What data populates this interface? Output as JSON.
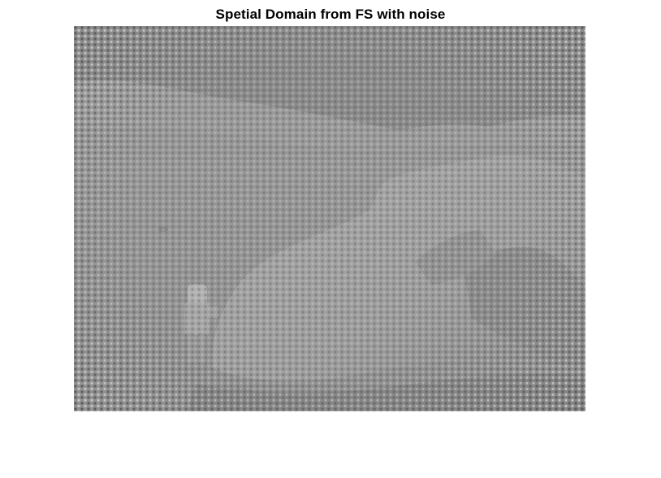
{
  "figure": {
    "title": "Spetial Domain from FS with noise",
    "colormap": "gray",
    "axis": "off"
  },
  "image": {
    "subject": "lunar-surface-astronaut-boulder",
    "noise_pattern": "periodic-dot-grid",
    "colors": {
      "background": "#ffffff",
      "base_gray": "#8f8f8f",
      "sky_gray": "#8a8a8a",
      "hills_gray": "#9c9c9c",
      "ground_gray": "#959595",
      "boulder_gray": "#a3a3a3",
      "shadow_gray": "#7e7e7e"
    }
  }
}
